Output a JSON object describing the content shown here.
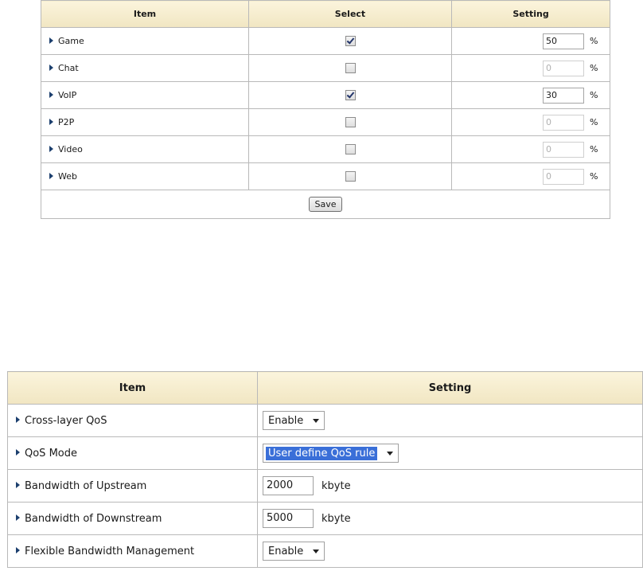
{
  "top_table": {
    "headers": {
      "item": "Item",
      "select": "Select",
      "setting": "Setting"
    },
    "percent_sign": "%",
    "rows": [
      {
        "label": "Game",
        "selected": true,
        "value": "50",
        "enabled": true
      },
      {
        "label": "Chat",
        "selected": false,
        "value": "0",
        "enabled": false
      },
      {
        "label": "VoIP",
        "selected": true,
        "value": "30",
        "enabled": true
      },
      {
        "label": "P2P",
        "selected": false,
        "value": "0",
        "enabled": false
      },
      {
        "label": "Video",
        "selected": false,
        "value": "0",
        "enabled": false
      },
      {
        "label": "Web",
        "selected": false,
        "value": "0",
        "enabled": false
      }
    ],
    "save_label": "Save"
  },
  "bottom_table": {
    "headers": {
      "item": "Item",
      "setting": "Setting"
    },
    "unit": "kbyte",
    "rows": {
      "cross_layer_qos": {
        "label": "Cross-layer QoS",
        "value": "Enable"
      },
      "qos_mode": {
        "label": "QoS Mode",
        "value": "User define QoS rule"
      },
      "upstream": {
        "label": "Bandwidth of Upstream",
        "value": "2000"
      },
      "downstream": {
        "label": "Bandwidth of Downstream",
        "value": "5000"
      },
      "flexible_bw": {
        "label": "Flexible Bandwidth Management",
        "value": "Enable"
      }
    }
  },
  "colors": {
    "header_bg": "#f3e9c8",
    "arrow": "#1c3f6e",
    "selection_highlight": "#3a6fd8"
  }
}
